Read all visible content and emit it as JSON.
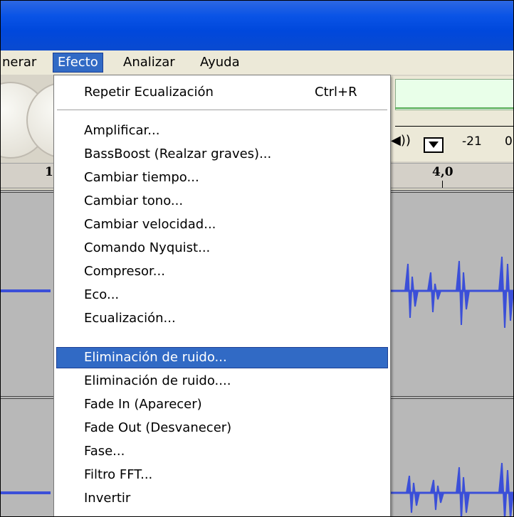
{
  "menubar": {
    "items": [
      {
        "label": "nerar"
      },
      {
        "label": "Efecto"
      },
      {
        "label": "Analizar"
      },
      {
        "label": "Ayuda"
      }
    ]
  },
  "toolbar": {
    "meter_values": [
      "-21",
      "0"
    ],
    "speaker_glyph": "◀))"
  },
  "ruler": {
    "labels": [
      "1",
      "4,0"
    ]
  },
  "effect_menu": {
    "first": {
      "label": "Repetir Ecualización",
      "shortcut": "Ctrl+R"
    },
    "items": [
      {
        "label": "Amplificar..."
      },
      {
        "label": "BassBoost (Realzar graves)..."
      },
      {
        "label": "Cambiar tiempo..."
      },
      {
        "label": "Cambiar tono..."
      },
      {
        "label": "Cambiar velocidad..."
      },
      {
        "label": "Comando Nyquist..."
      },
      {
        "label": "Compresor..."
      },
      {
        "label": "Eco..."
      },
      {
        "label": "Ecualización..."
      },
      {
        "label": "Eliminación de ruido...",
        "highlighted": true
      },
      {
        "label": "Eliminación de ruido...."
      },
      {
        "label": "Fade In (Aparecer)"
      },
      {
        "label": "Fade Out (Desvanecer)"
      },
      {
        "label": "Fase..."
      },
      {
        "label": "Filtro FFT..."
      },
      {
        "label": "Invertir"
      }
    ]
  },
  "colors": {
    "title_bar": "#0a54e6",
    "highlight": "#316ac5",
    "waveform": "#3b4fd8"
  }
}
